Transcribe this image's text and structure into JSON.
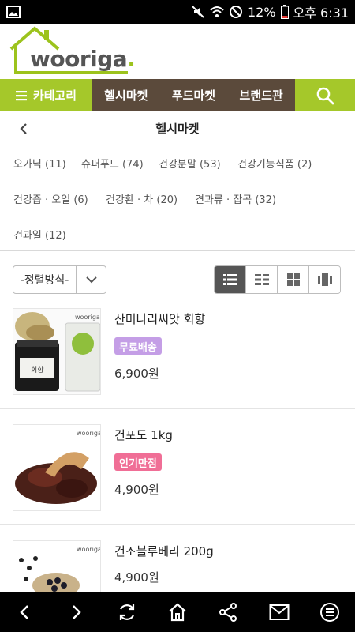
{
  "status_bar": {
    "battery": "12%",
    "time": "오후 6:31",
    "icons": [
      "image-icon",
      "mute-icon",
      "wifi-icon",
      "blocked-icon",
      "battery-icon"
    ]
  },
  "logo": {
    "text": "wooriga",
    "dot": "."
  },
  "nav": {
    "category_label": "카테고리",
    "items": [
      "헬시마켓",
      "푸드마켓",
      "브랜드관"
    ],
    "colors": {
      "green": "#a5c82a",
      "brown": "#5b4a3b"
    }
  },
  "page": {
    "title": "헬시마켓"
  },
  "categories": [
    "오가닉 (11)",
    "슈퍼푸드 (74)",
    "건강분말 (53)",
    "건강기능식품 (2)",
    "건강즙 · 오일 (6)",
    "건강환 · 차 (20)",
    "견과류 · 잡곡 (32)",
    "건과일 (12)"
  ],
  "sort": {
    "label": "-정렬방식-"
  },
  "view_modes": [
    "list-view-icon",
    "grid-small-icon",
    "grid-large-icon",
    "carousel-view-icon"
  ],
  "products": [
    {
      "name": "산미나리씨앗 회향",
      "badge": "무료배송",
      "badge_color": "#c49ee6",
      "price": "6,900원",
      "thumb_labels": [
        "wooriga",
        "회향"
      ]
    },
    {
      "name": "건포도 1kg",
      "badge": "인기만점",
      "badge_color": "#f06e96",
      "price": "4,900원",
      "thumb_labels": [
        "wooriga"
      ]
    },
    {
      "name": "건조블루베리 200g",
      "badge": "",
      "badge_color": "",
      "price": "4,900원",
      "thumb_labels": [
        "wooriga"
      ]
    }
  ],
  "bottom_bar": [
    "back-icon",
    "forward-icon",
    "refresh-icon",
    "home-icon",
    "share-icon",
    "mail-icon",
    "menu-icon"
  ]
}
